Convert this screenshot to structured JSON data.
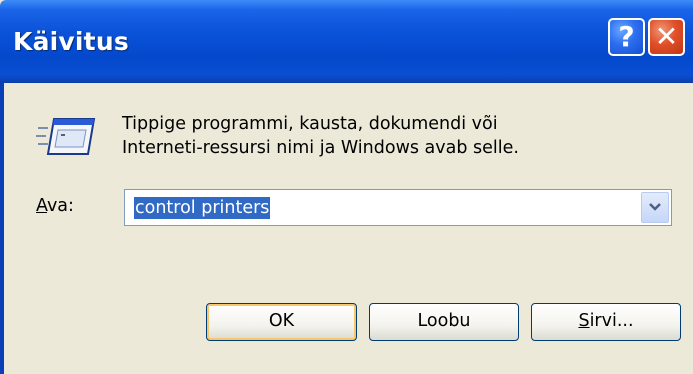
{
  "window": {
    "title": "Käivitus",
    "help_label": "?",
    "close_label": "✕"
  },
  "message": {
    "line1": "Tippige programmi, kausta, dokumendi või",
    "line2": "Interneti-ressursi nimi ja Windows avab selle."
  },
  "open_field": {
    "label_prefix": "",
    "label_accel": "A",
    "label_rest": "va:",
    "value": "control printers"
  },
  "buttons": {
    "ok": "OK",
    "cancel": "Loobu",
    "browse_accel": "S",
    "browse_rest": "irvi..."
  },
  "colors": {
    "titlebar": "#0a52d8",
    "dialog_bg": "#ece9d8",
    "selection": "#316ac5"
  },
  "icons": {
    "run": "run-icon",
    "help": "help-icon",
    "close": "close-icon",
    "dropdown": "chevron-down-icon"
  }
}
